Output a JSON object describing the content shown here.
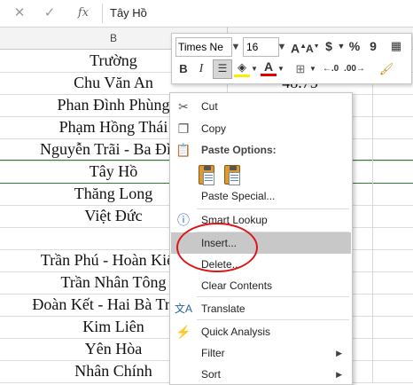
{
  "formula_bar": {
    "cancel_icon": "✕",
    "enter_icon": "✓",
    "function_icon": "fx",
    "value": "Tây Hồ"
  },
  "sheet": {
    "column_header": "B",
    "rows": [
      {
        "b": "Trường",
        "c": ""
      },
      {
        "b": "Chu Văn An",
        "c": "48.75"
      },
      {
        "b": "Phan Đình Phùng",
        "c": ""
      },
      {
        "b": "Phạm Hồng Thái",
        "c": ""
      },
      {
        "b": "Nguyễn Trãi - Ba Đình",
        "c": ""
      },
      {
        "b": "Tây Hồ",
        "c": ""
      },
      {
        "b": "Thăng Long",
        "c": ""
      },
      {
        "b": "Việt Đức",
        "c": ""
      },
      {
        "b": "",
        "c": ""
      },
      {
        "b": "Trần Phú - Hoàn Kiếm",
        "c": ""
      },
      {
        "b": "Trần Nhân Tông",
        "c": ""
      },
      {
        "b": "Đoàn Kết - Hai Bà Trưng",
        "c": ""
      },
      {
        "b": "Kim Liên",
        "c": ""
      },
      {
        "b": "Yên Hòa",
        "c": ""
      },
      {
        "b": "Nhân Chính",
        "c": ""
      }
    ]
  },
  "mini_toolbar": {
    "font_name": "Times Ne",
    "font_size": "16",
    "grow_font": "A",
    "shrink_font": "A",
    "currency": "$",
    "percent": "%",
    "comma": "9",
    "bold": "B",
    "italic": "I",
    "font_color": "A",
    "increase_decimal": "←.0",
    "decrease_decimal": ".00→"
  },
  "context_menu": {
    "items": [
      {
        "label": "Cut",
        "icon": "scissors-icon"
      },
      {
        "label": "Copy",
        "icon": "copy-icon"
      },
      {
        "label": "Paste Options:",
        "icon": "paste-icon"
      },
      {
        "label": "Paste Special...",
        "icon": ""
      },
      {
        "label": "Smart Lookup",
        "icon": "smart-lookup-icon"
      },
      {
        "label": "Insert...",
        "icon": ""
      },
      {
        "label": "Delete...",
        "icon": ""
      },
      {
        "label": "Clear Contents",
        "icon": ""
      },
      {
        "label": "Translate",
        "icon": "translate-icon"
      },
      {
        "label": "Quick Analysis",
        "icon": "quick-analysis-icon"
      },
      {
        "label": "Filter",
        "icon": ""
      },
      {
        "label": "Sort",
        "icon": ""
      }
    ]
  },
  "colors": {
    "highlight_ring": "#e01414",
    "active_row_border": "#2e7d32",
    "hover_background": "#c8c8c8"
  }
}
